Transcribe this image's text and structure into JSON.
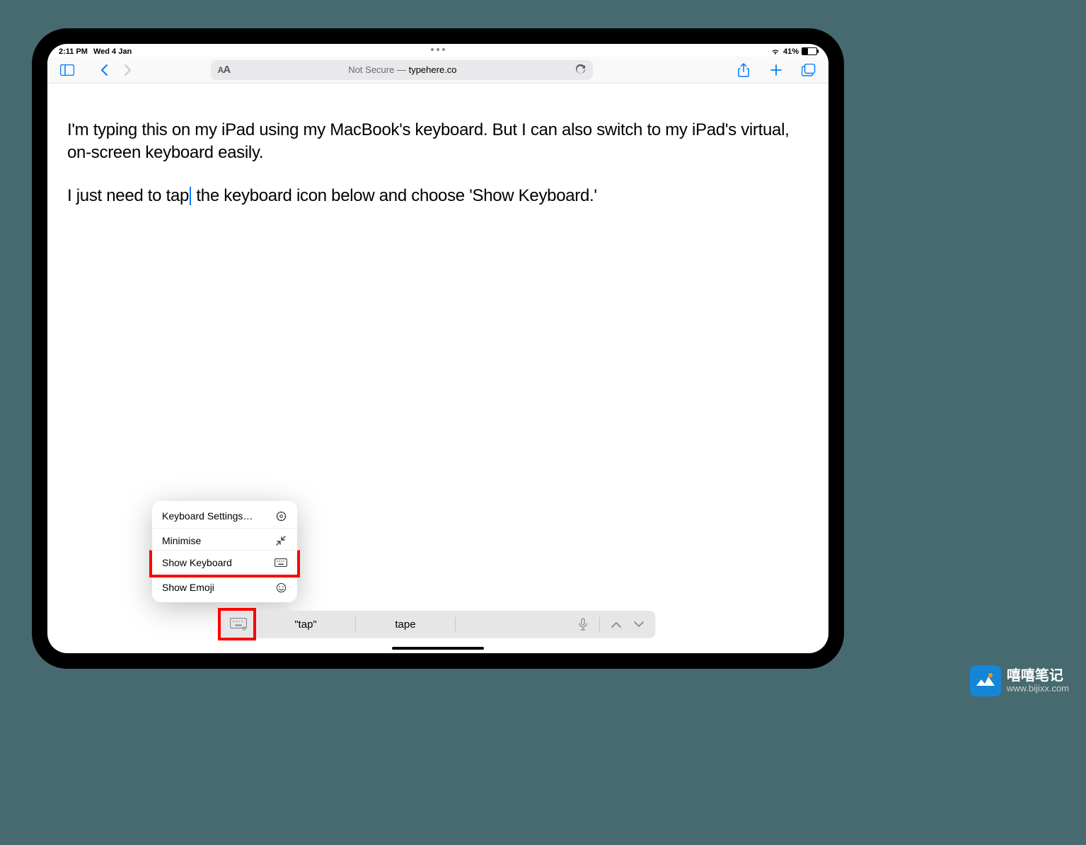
{
  "status_bar": {
    "time": "2:11 PM",
    "date": "Wed 4 Jan",
    "battery_percent": "41%"
  },
  "toolbar": {
    "address_prefix": "Not Secure — ",
    "address_domain": "typehere.co"
  },
  "content": {
    "paragraph1": "I'm typing this on my iPad using my MacBook's keyboard. But I can also switch to my iPad's virtual, on-screen keyboard easily.",
    "paragraph2_before": "I just need to tap",
    "paragraph2_after": " the keyboard icon below and choose 'Show Keyboard.'"
  },
  "keyboard_menu": {
    "items": [
      {
        "label": "Keyboard Settings…",
        "icon": "gear"
      },
      {
        "label": "Minimise",
        "icon": "minimise"
      },
      {
        "label": "Show Keyboard",
        "icon": "keyboard",
        "highlighted": true
      },
      {
        "label": "Show Emoji",
        "icon": "emoji"
      }
    ]
  },
  "suggestions": {
    "item1": "\"tap\"",
    "item2": "tape"
  },
  "watermark": {
    "title": "嘻嘻笔记",
    "url": "www.bijixx.com"
  }
}
